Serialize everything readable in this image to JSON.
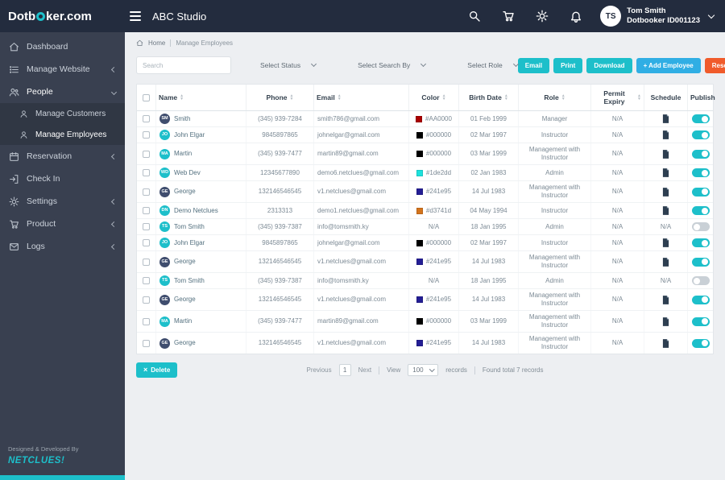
{
  "colors": {
    "accent_teal": "#1dbfca",
    "accent_blue": "#30aee4",
    "accent_orange": "#f05b2b",
    "header_bg": "#232c3e",
    "sidebar_bg": "#394050",
    "sidebar_sub_bg": "#303744",
    "toggle_off": "#c9d0d6"
  },
  "header": {
    "logo_text_before": "Dotb",
    "logo_text_after": "ker.com",
    "studio_name": "ABC Studio",
    "icons": [
      "search",
      "cart",
      "gear",
      "bell"
    ],
    "user_initials": "TS",
    "user_name": "Tom Smith",
    "user_id": "Dotbooker ID001123"
  },
  "sidebar": {
    "items": [
      {
        "label": "Dashboard",
        "icon": "home"
      },
      {
        "label": "Manage Website",
        "icon": "list",
        "chevron": "left"
      },
      {
        "label": "People",
        "icon": "users",
        "chevron": "down",
        "active": true
      },
      {
        "label": "Manage Customers",
        "icon": "user",
        "sub": true
      },
      {
        "label": "Manage Employees",
        "icon": "user",
        "sub": true,
        "active": true
      },
      {
        "label": "Reservation",
        "icon": "calendar",
        "chevron": "left"
      },
      {
        "label": "Check In",
        "icon": "checkin"
      },
      {
        "label": "Settings",
        "icon": "gear",
        "chevron": "left"
      },
      {
        "label": "Product",
        "icon": "cart",
        "chevron": "left"
      },
      {
        "label": "Logs",
        "icon": "envelope",
        "chevron": "left"
      }
    ],
    "credit_line": "Designed & Developed By",
    "credit_brand": "NETCLUES!"
  },
  "breadcrumb": {
    "home_label": "Home",
    "current": "Manage Employees"
  },
  "filters": {
    "search_placeholder": "Search",
    "selects": [
      {
        "label": "Select Status"
      },
      {
        "label": "Select Search By"
      },
      {
        "label": "Select Role"
      }
    ],
    "buttons": [
      {
        "label": "Email",
        "style": "teal"
      },
      {
        "label": "Print",
        "style": "teal"
      },
      {
        "label": "Download",
        "style": "teal"
      },
      {
        "label": "+ Add Employee",
        "style": "blue"
      },
      {
        "label": "Reset",
        "style": "orange"
      }
    ]
  },
  "table": {
    "columns": [
      {
        "key": "name",
        "label": "Name",
        "sortable": true
      },
      {
        "key": "phone",
        "label": "Phone",
        "sortable": true
      },
      {
        "key": "email",
        "label": "Email",
        "sortable": true
      },
      {
        "key": "color",
        "label": "Color",
        "sortable": true
      },
      {
        "key": "birth",
        "label": "Birth Date",
        "sortable": true
      },
      {
        "key": "role",
        "label": "Role",
        "sortable": true
      },
      {
        "key": "permit",
        "label": "Permit Expiry",
        "sortable": true
      },
      {
        "key": "schedule",
        "label": "Schedule",
        "sortable": false
      },
      {
        "key": "publish",
        "label": "Publish",
        "sortable": false
      }
    ],
    "rows": [
      {
        "initials": "SM",
        "avatar_color": "#3f4d6e",
        "name": "Smith",
        "phone": "(345) 939-7284",
        "email": "smith786@gmail.com",
        "color_hex": "#AA0000",
        "birth": "01 Feb 1999",
        "role": "Manager",
        "permit": "N/A",
        "schedule": "doc",
        "publish": true
      },
      {
        "initials": "JO",
        "avatar_color": "#1dbfca",
        "name": "John Elgar",
        "phone": "9845897865",
        "email": "johnelgar@gmail.com",
        "color_hex": "#000000",
        "birth": "02 Mar 1997",
        "role": "Instructor",
        "permit": "N/A",
        "schedule": "doc",
        "publish": true
      },
      {
        "initials": "MA",
        "avatar_color": "#1dbfca",
        "name": "Martin",
        "phone": "(345) 939-7477",
        "email": "martin89@gmail.com",
        "color_hex": "#000000",
        "birth": "03 Mar 1999",
        "role": "Management with Instructor",
        "permit": "N/A",
        "schedule": "doc",
        "publish": true
      },
      {
        "initials": "WD",
        "avatar_color": "#1dbfca",
        "name": "Web Dev",
        "phone": "12345677890",
        "email": "demo6.netclues@gmail.com",
        "color_hex": "#1de2dd",
        "birth": "02 Jan 1983",
        "role": "Admin",
        "permit": "N/A",
        "schedule": "doc",
        "publish": true
      },
      {
        "initials": "GE",
        "avatar_color": "#3f4d6e",
        "name": "George",
        "phone": "132146546545",
        "email": "v1.netclues@gmail.com",
        "color_hex": "#241e95",
        "birth": "14 Jul 1983",
        "role": "Management with Instructor",
        "permit": "N/A",
        "schedule": "doc",
        "publish": true
      },
      {
        "initials": "DN",
        "avatar_color": "#1dbfca",
        "name": "Demo Netclues",
        "phone": "2313313",
        "email": "demo1.netclues@gmail.com",
        "color_hex": "#d3741d",
        "birth": "04 May 1994",
        "role": "Instructor",
        "permit": "N/A",
        "schedule": "doc",
        "publish": true
      },
      {
        "initials": "TS",
        "avatar_color": "#1dbfca",
        "name": "Tom Smith",
        "phone": "(345) 939-7387",
        "email": "info@tomsmith.ky",
        "color_hex": "N/A",
        "birth": "18 Jan 1995",
        "role": "Admin",
        "permit": "N/A",
        "schedule": "N/A",
        "publish": false
      },
      {
        "initials": "JO",
        "avatar_color": "#1dbfca",
        "name": "John Elgar",
        "phone": "9845897865",
        "email": "johnelgar@gmail.com",
        "color_hex": "#000000",
        "birth": "02 Mar 1997",
        "role": "Instructor",
        "permit": "N/A",
        "schedule": "doc",
        "publish": true
      },
      {
        "initials": "GE",
        "avatar_color": "#3f4d6e",
        "name": "George",
        "phone": "132146546545",
        "email": "v1.netclues@gmail.com",
        "color_hex": "#241e95",
        "birth": "14 Jul 1983",
        "role": "Management with Instructor",
        "permit": "N/A",
        "schedule": "doc",
        "publish": true
      },
      {
        "initials": "TS",
        "avatar_color": "#1dbfca",
        "name": "Tom Smith",
        "phone": "(345) 939-7387",
        "email": "info@tomsmith.ky",
        "color_hex": "N/A",
        "birth": "18 Jan 1995",
        "role": "Admin",
        "permit": "N/A",
        "schedule": "N/A",
        "publish": false
      },
      {
        "initials": "GE",
        "avatar_color": "#3f4d6e",
        "name": "George",
        "phone": "132146546545",
        "email": "v1.netclues@gmail.com",
        "color_hex": "#241e95",
        "birth": "14 Jul 1983",
        "role": "Management with Instructor",
        "permit": "N/A",
        "schedule": "doc",
        "publish": true
      },
      {
        "initials": "MA",
        "avatar_color": "#1dbfca",
        "name": "Martin",
        "phone": "(345) 939-7477",
        "email": "martin89@gmail.com",
        "color_hex": "#000000",
        "birth": "03 Mar 1999",
        "role": "Management with Instructor",
        "permit": "N/A",
        "schedule": "doc",
        "publish": true
      },
      {
        "initials": "GE",
        "avatar_color": "#3f4d6e",
        "name": "George",
        "phone": "132146546545",
        "email": "v1.netclues@gmail.com",
        "color_hex": "#241e95",
        "birth": "14 Jul 1983",
        "role": "Management with Instructor",
        "permit": "N/A",
        "schedule": "doc",
        "publish": true
      }
    ]
  },
  "footer": {
    "delete_label": "Delete",
    "prev_label": "Previous",
    "page": "1",
    "next_label": "Next",
    "view_label": "View",
    "per_page": "100",
    "records_label": "records",
    "found_text": "Found total 7 records"
  }
}
